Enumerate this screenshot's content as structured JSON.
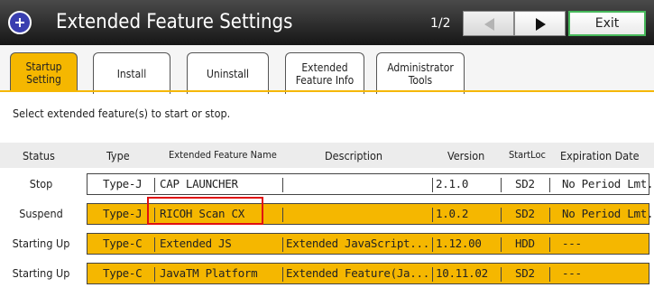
{
  "header": {
    "title": "Extended Feature Settings",
    "page_indicator": "1/2",
    "exit_label": "Exit"
  },
  "tabs": [
    {
      "label": "Startup\nSetting",
      "active": true
    },
    {
      "label": "Install",
      "active": false
    },
    {
      "label": "Uninstall",
      "active": false
    },
    {
      "label": "Extended\nFeature Info",
      "active": false
    },
    {
      "label": "Administrator\nTools",
      "active": false
    }
  ],
  "instruction": "Select extended feature(s) to start or stop.",
  "columns": {
    "status": "Status",
    "type": "Type",
    "name": "Extended Feature Name",
    "description": "Description",
    "version": "Version",
    "startloc": "StartLoc",
    "expiration": "Expiration Date"
  },
  "rows": [
    {
      "status": "Stop",
      "type": "Type-J",
      "name": "CAP LAUNCHER",
      "description": "",
      "version": "2.1.0",
      "startloc": "SD2",
      "expiration": "No Period Lmt."
    },
    {
      "status": "Suspend",
      "type": "Type-J",
      "name": "RICOH Scan CX",
      "description": "",
      "version": "1.0.2",
      "startloc": "SD2",
      "expiration": "No Period Lmt."
    },
    {
      "status": "Starting Up",
      "type": "Type-C",
      "name": "Extended JS",
      "description": "Extended JavaScript...",
      "version": "1.12.00",
      "startloc": "HDD",
      "expiration": "---"
    },
    {
      "status": "Starting Up",
      "type": "Type-C",
      "name": "JavaTM Platform",
      "description": "Extended Feature(Ja...",
      "version": "10.11.02",
      "startloc": "SD2",
      "expiration": "---"
    }
  ],
  "colors": {
    "selected_row": "#f5b700",
    "active_tab": "#f5b700",
    "exit_border": "#46b85a",
    "highlight_box": "#e01010"
  }
}
